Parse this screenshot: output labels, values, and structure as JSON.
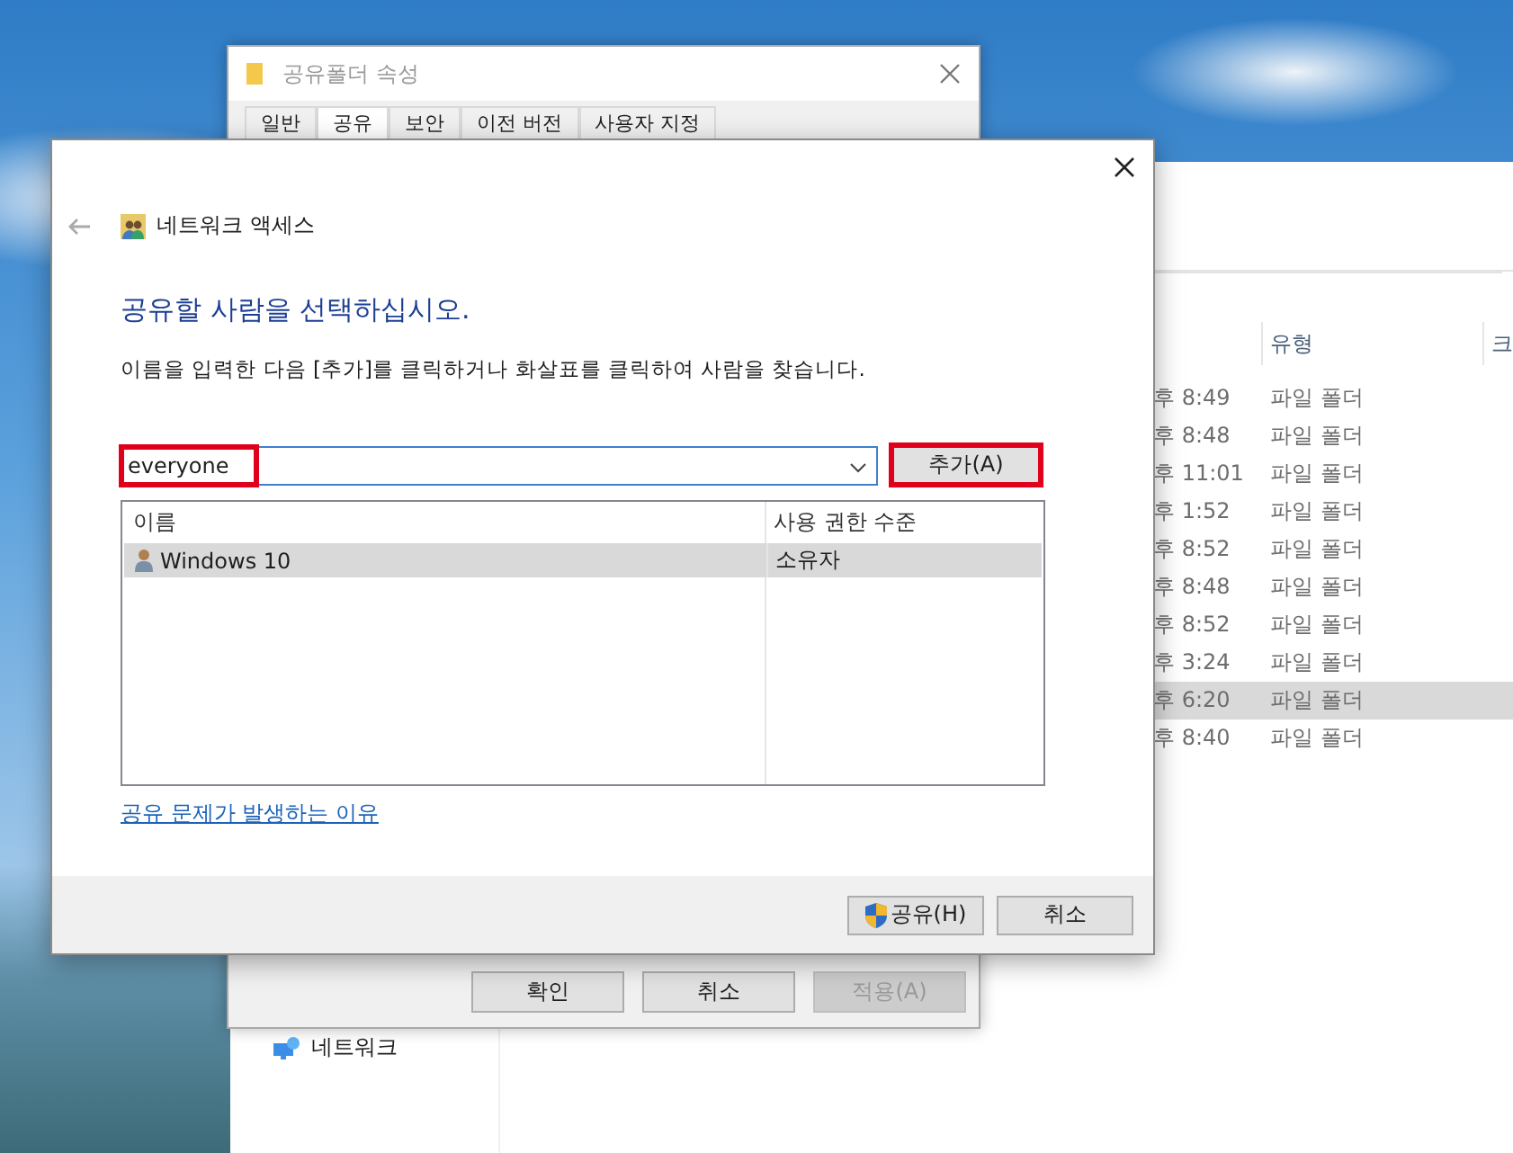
{
  "explorer": {
    "nav_items": [
      {
        "label": "네트워크"
      }
    ],
    "columns": [
      "유형",
      "크"
    ],
    "rows": [
      {
        "date": "후 8:49",
        "type": "파일 폴더",
        "selected": false
      },
      {
        "date": "후 8:48",
        "type": "파일 폴더",
        "selected": false
      },
      {
        "date": "후 11:01",
        "type": "파일 폴더",
        "selected": false
      },
      {
        "date": "후 1:52",
        "type": "파일 폴더",
        "selected": false
      },
      {
        "date": "후 8:52",
        "type": "파일 폴더",
        "selected": false
      },
      {
        "date": "후 8:48",
        "type": "파일 폴더",
        "selected": false
      },
      {
        "date": "후 8:52",
        "type": "파일 폴더",
        "selected": false
      },
      {
        "date": "후 3:24",
        "type": "파일 폴더",
        "selected": false
      },
      {
        "date": "후 6:20",
        "type": "파일 폴더",
        "selected": true
      },
      {
        "date": "후 8:40",
        "type": "파일 폴더",
        "selected": false
      }
    ]
  },
  "properties_dialog": {
    "title": "공유폴더 속성",
    "tabs": [
      {
        "label": "일반",
        "selected": false
      },
      {
        "label": "공유",
        "selected": true
      },
      {
        "label": "보안",
        "selected": false
      },
      {
        "label": "이전 버전",
        "selected": false
      },
      {
        "label": "사용자 지정",
        "selected": false
      }
    ],
    "buttons": [
      {
        "label": "확인",
        "disabled": false
      },
      {
        "label": "취소",
        "disabled": false
      },
      {
        "label": "적용(A)",
        "disabled": true
      }
    ]
  },
  "share_dialog": {
    "title": "네트워크 액세스",
    "heading": "공유할 사람을 선택하십시오.",
    "instruction": "이름을 입력한 다음 [추가]를 클릭하거나 화살표를 클릭하여 사람을 찾습니다.",
    "name_field": {
      "value": "everyone",
      "highlighted": true
    },
    "add_button": {
      "label": "추가(A)",
      "highlighted": true
    },
    "list": {
      "columns": [
        "이름",
        "사용 권한 수준"
      ],
      "rows": [
        {
          "name": "Windows 10",
          "permission": "소유자",
          "selected": true
        }
      ]
    },
    "help_link": "공유 문제가 발생하는 이유",
    "buttons": [
      {
        "label": "공유(H)",
        "kind": "shield"
      },
      {
        "label": "취소",
        "kind": "plain"
      }
    ]
  }
}
